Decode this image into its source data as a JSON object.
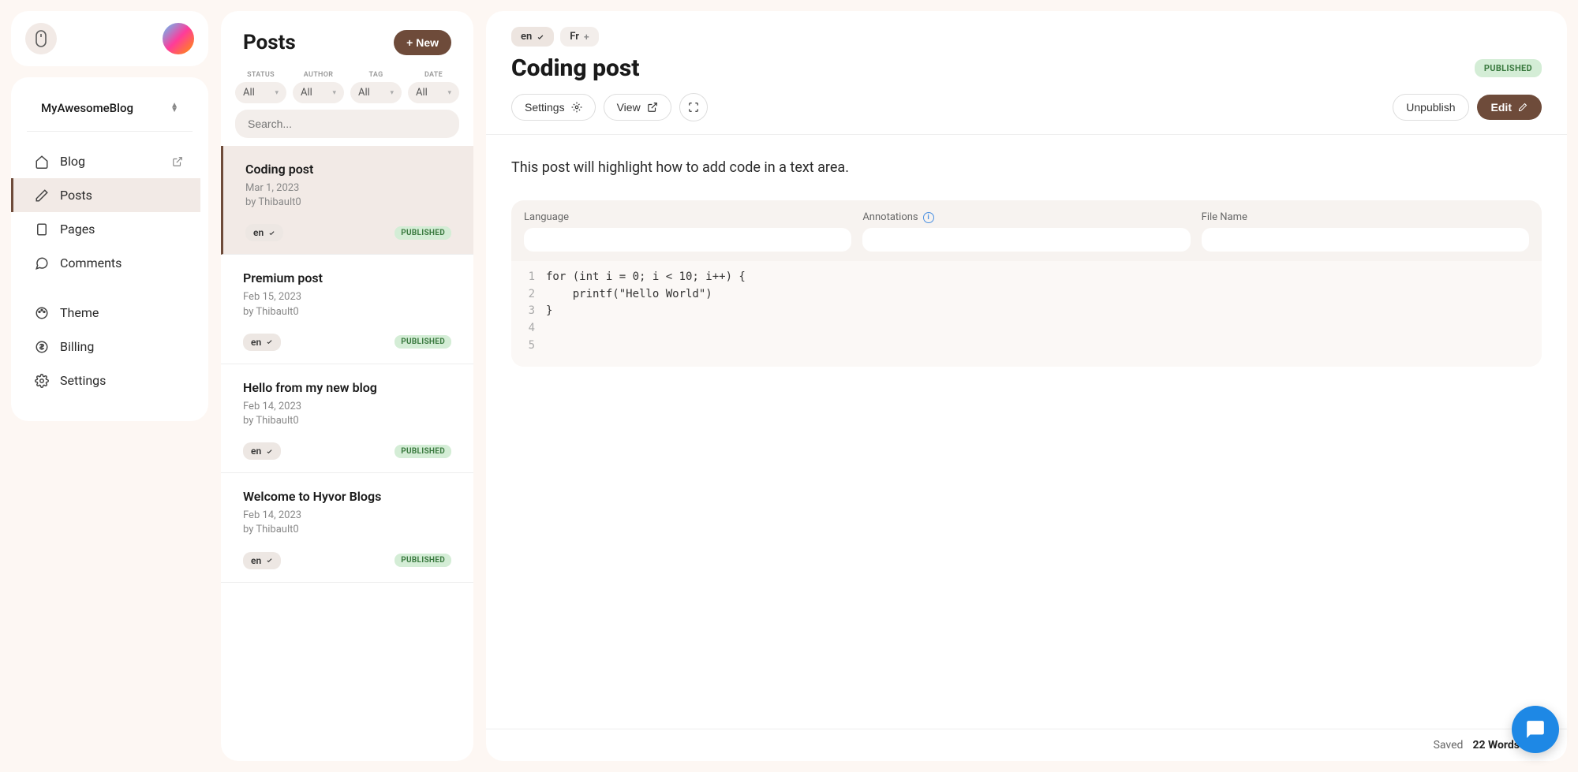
{
  "topbar": {
    "blog_name": "MyAwesomeBlog"
  },
  "nav": {
    "blog": "Blog",
    "posts": "Posts",
    "pages": "Pages",
    "comments": "Comments",
    "theme": "Theme",
    "billing": "Billing",
    "settings": "Settings"
  },
  "posts_panel": {
    "title": "Posts",
    "new_btn": "+ New",
    "filters": {
      "status": {
        "label": "STATUS",
        "value": "All"
      },
      "author": {
        "label": "AUTHOR",
        "value": "All"
      },
      "tag": {
        "label": "TAG",
        "value": "All"
      },
      "date": {
        "label": "DATE",
        "value": "All"
      }
    },
    "search_placeholder": "Search...",
    "items": [
      {
        "title": "Coding post",
        "date": "Mar 1, 2023",
        "author": "by Thibault0",
        "lang": "en",
        "status": "PUBLISHED"
      },
      {
        "title": "Premium post",
        "date": "Feb 15, 2023",
        "author": "by Thibault0",
        "lang": "en",
        "status": "PUBLISHED"
      },
      {
        "title": "Hello from my new blog",
        "date": "Feb 14, 2023",
        "author": "by Thibault0",
        "lang": "en",
        "status": "PUBLISHED"
      },
      {
        "title": "Welcome to Hyvor Blogs",
        "date": "Feb 14, 2023",
        "author": "by Thibault0",
        "lang": "en",
        "status": "PUBLISHED"
      }
    ]
  },
  "editor": {
    "langs": {
      "active": "en",
      "other": "Fr"
    },
    "title": "Coding post",
    "status": "PUBLISHED",
    "actions": {
      "settings": "Settings",
      "view": "View",
      "unpublish": "Unpublish",
      "edit": "Edit"
    },
    "body_text": "This post will highlight how to add code in a text area.",
    "code": {
      "labels": {
        "language": "Language",
        "annotations": "Annotations",
        "filename": "File Name"
      },
      "lines": [
        "for (int i = 0; i < 10; i++) {",
        "    printf(\"Hello World\")",
        "}",
        "",
        ""
      ]
    },
    "footer": {
      "saved": "Saved",
      "wordcount": "22 Words"
    }
  }
}
